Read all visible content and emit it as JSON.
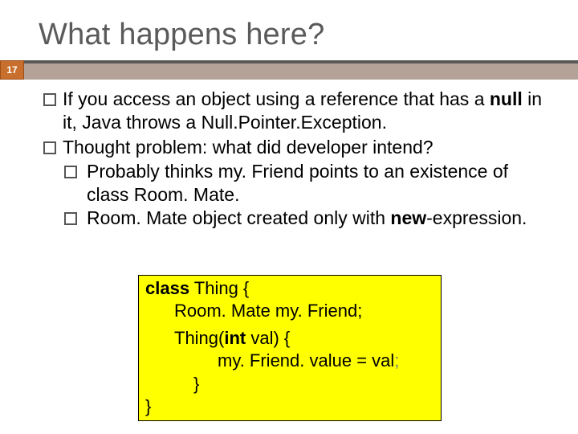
{
  "page_number": "17",
  "title": "What happens here?",
  "bullets": {
    "b1_pre": "If you access an object using a reference that has a ",
    "b1_null": "null",
    "b1_mid": " in it, Java throws a ",
    "b1_npe": "Null.Pointer.Exception",
    "b1_end": ".",
    "b2": "Thought problem: what did developer intend?",
    "b2a_pre": "Probably thinks ",
    "b2a_mf": "my. Friend",
    "b2a_mid": " points to an existence of class ",
    "b2a_rm": "Room. Mate",
    "b2a_end": ".",
    "b2b_rm": "Room. Mate",
    "b2b_mid": " object created only with ",
    "b2b_new": "new",
    "b2b_end": "-expression."
  },
  "code": {
    "l1a": "class",
    "l1b": " Thing {",
    "l2": "Room. Mate my. Friend;",
    "l3a": "Thing(",
    "l3b": "int",
    "l3c": " val) {",
    "l4a": "my. Friend. value = val",
    "l4b": ";",
    "l5": "}",
    "l6": "}"
  }
}
